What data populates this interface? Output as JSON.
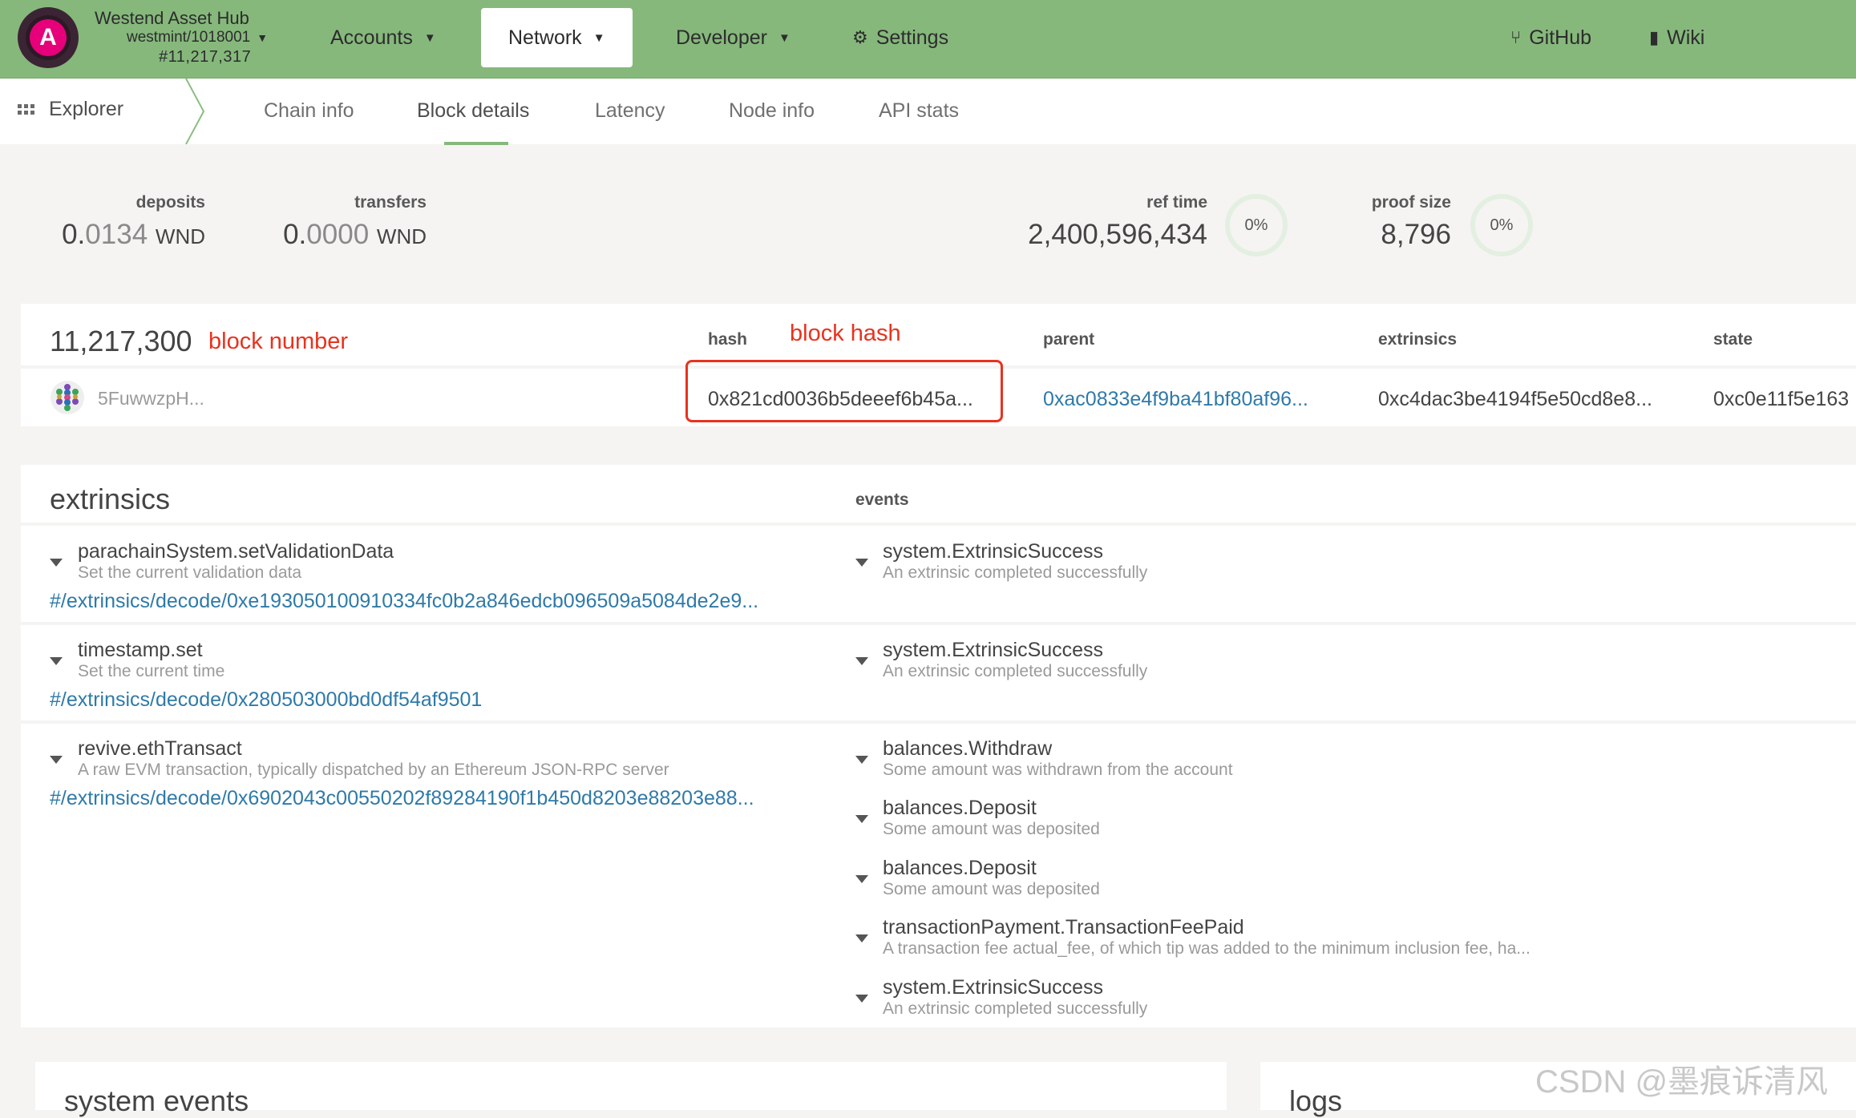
{
  "header": {
    "logo_letter": "A",
    "chain_name": "Westend Asset Hub",
    "chain_spec": "westmint/1018001",
    "best_block": "#11,217,317",
    "nav": {
      "accounts": "Accounts",
      "network": "Network",
      "developer": "Developer",
      "settings": "Settings",
      "github": "GitHub",
      "wiki": "Wiki"
    }
  },
  "subnav": {
    "explorer": "Explorer",
    "tabs": [
      "Chain info",
      "Block details",
      "Latency",
      "Node info",
      "API stats"
    ]
  },
  "summary": {
    "deposits_label": "deposits",
    "deposits_int": "0.",
    "deposits_frac": "0134",
    "deposits_unit": "WND",
    "transfers_label": "transfers",
    "transfers_int": "0.",
    "transfers_frac": "0000",
    "transfers_unit": "WND",
    "ref_time_label": "ref time",
    "ref_time_value": "2,400,596,434",
    "ref_time_pct": "0%",
    "proof_size_label": "proof size",
    "proof_size_value": "8,796",
    "proof_size_pct": "0%"
  },
  "block": {
    "number": "11,217,300",
    "author": "5FuwwzpH...",
    "headers": {
      "hash": "hash",
      "parent": "parent",
      "extrinsics": "extrinsics",
      "state": "state"
    },
    "hash": "0x821cd0036b5deeef6b45a...",
    "parent": "0xac0833e4f9ba41bf80af96...",
    "extrinsics_root": "0xc4dac3be4194f5e50cd8e8...",
    "state_root": "0xc0e11f5e163"
  },
  "annotations": {
    "block_number": "block number",
    "block_hash": "block hash"
  },
  "extrinsics_section": {
    "title": "extrinsics",
    "events_header": "events",
    "rows": [
      {
        "name": "parachainSystem.setValidationData",
        "desc": "Set the current validation data",
        "link": "#/extrinsics/decode/0xe193050100910334fc0b2a846edcb096509a5084de2e9...",
        "events": [
          {
            "name": "system.ExtrinsicSuccess",
            "desc": "An extrinsic completed successfully"
          }
        ]
      },
      {
        "name": "timestamp.set",
        "desc": "Set the current time",
        "link": "#/extrinsics/decode/0x280503000bd0df54af9501",
        "events": [
          {
            "name": "system.ExtrinsicSuccess",
            "desc": "An extrinsic completed successfully"
          }
        ]
      },
      {
        "name": "revive.ethTransact",
        "desc": "A raw EVM transaction, typically dispatched by an Ethereum JSON-RPC server",
        "link": "#/extrinsics/decode/0x6902043c00550202f89284190f1b450d8203e88203e88...",
        "events": [
          {
            "name": "balances.Withdraw",
            "desc": "Some amount was withdrawn from the account"
          },
          {
            "name": "balances.Deposit",
            "desc": "Some amount was deposited"
          },
          {
            "name": "balances.Deposit",
            "desc": "Some amount was deposited"
          },
          {
            "name": "transactionPayment.TransactionFeePaid",
            "desc": "A transaction fee actual_fee, of which tip was added to the minimum inclusion fee, ha..."
          },
          {
            "name": "system.ExtrinsicSuccess",
            "desc": "An extrinsic completed successfully"
          }
        ]
      }
    ]
  },
  "bottom": {
    "system_events": "system events",
    "logs": "logs"
  },
  "watermark": "CSDN @墨痕诉清风",
  "colors": {
    "topbar": "#86b87c",
    "link": "#2f7aa8",
    "annotation": "#e9321e"
  }
}
